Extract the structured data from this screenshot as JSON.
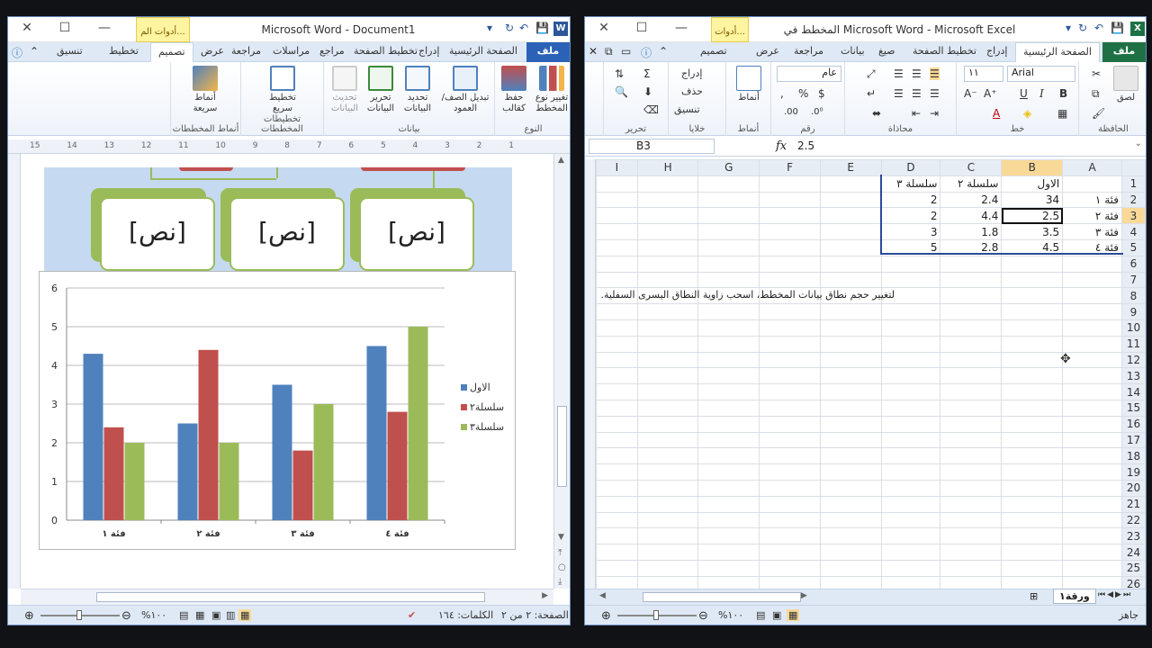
{
  "word": {
    "title": "Microsoft Word  -  Document1",
    "context_tab": "أدوات الم...",
    "tabs": [
      "ملف",
      "الصفحة الرئيسية",
      "إدراج",
      "تخطيط الصفحة",
      "مراجع",
      "مراسلات",
      "مراجعة",
      "عرض",
      "تصميم",
      "تخطيط",
      "تنسيق"
    ],
    "ribbon": {
      "groups": [
        {
          "label": "النوع",
          "buttons": [
            "تغيير نوع المخطط",
            "حفظ كقالب"
          ]
        },
        {
          "label": "بيانات",
          "buttons": [
            "تبديل الصف/العمود",
            "تحديد البيانات",
            "تحرير البيانات",
            "تحديث البيانات"
          ]
        },
        {
          "label": "تخطيطات المخططات",
          "buttons": [
            "تخطيط سريع"
          ]
        },
        {
          "label": "أنماط المخططات",
          "buttons": [
            "أنماط سريعة"
          ]
        }
      ]
    },
    "ruler_ticks": [
      "15",
      "14",
      "13",
      "12",
      "11",
      "10",
      "9",
      "8",
      "7",
      "6",
      "5",
      "4",
      "3",
      "2",
      "1"
    ],
    "smartart_text": "[نص]",
    "status": {
      "page": "الصفحة: ٢ من ٢",
      "words": "الكلمات: ١٦٤",
      "zoom": "%١٠٠"
    }
  },
  "excel": {
    "title": "المخطط في Microsoft Word  -  Microsoft Excel",
    "context_tab": "أدوات...",
    "tabs": [
      "ملف",
      "الصفحة الرئيسية",
      "إدراج",
      "تخطيط الصفحة",
      "صيغ",
      "بيانات",
      "مراجعة",
      "عرض",
      "تصميم"
    ],
    "ribbon": {
      "groups": [
        "الحافظة",
        "خط",
        "محاذاة",
        "رقم",
        "أنماط",
        "خلايا",
        "تحرير"
      ],
      "font_name": "Arial",
      "font_size": "١١",
      "number_format": "عام",
      "paste_label": "لصق",
      "styles_label": "أنماط",
      "cells_buttons": [
        "إدراج",
        "حذف",
        "تنسيق"
      ]
    },
    "name_box": "B3",
    "formula": "2.5",
    "columns": [
      "I",
      "H",
      "G",
      "F",
      "E",
      "D",
      "C",
      "B",
      "A"
    ],
    "rows": [
      [
        "",
        "",
        "",
        "",
        "",
        "سلسلة ٣",
        "سلسلة ٢",
        "الاول",
        ""
      ],
      [
        "",
        "",
        "",
        "",
        "",
        "2",
        "2.4",
        "34",
        "فئة ١"
      ],
      [
        "",
        "",
        "",
        "",
        "",
        "2",
        "4.4",
        "2.5",
        "فئة ٢"
      ],
      [
        "",
        "",
        "",
        "",
        "",
        "3",
        "1.8",
        "3.5",
        "فئة ٣"
      ],
      [
        "",
        "",
        "",
        "",
        "",
        "5",
        "2.8",
        "4.5",
        "فئة ٤"
      ]
    ],
    "total_rows": 26,
    "note": "لتغيير حجم نطاق بيانات المخطط، اسحب زاوية النطاق اليسرى السفلية.",
    "sheet_tab": "ورقة١",
    "status": "جاهز",
    "zoom": "%١٠٠"
  },
  "chart_data": {
    "type": "bar",
    "categories": [
      "فئة ١",
      "فئة ٢",
      "فئة ٣",
      "فئة ٤"
    ],
    "series": [
      {
        "name": "الاول",
        "color": "#4f81bd",
        "values": [
          4.3,
          2.5,
          3.5,
          4.5
        ]
      },
      {
        "name": "سلسلة٢",
        "color": "#c0504d",
        "values": [
          2.4,
          4.4,
          1.8,
          2.8
        ]
      },
      {
        "name": "سلسلة٣",
        "color": "#9bbb59",
        "values": [
          2,
          2,
          3,
          5
        ]
      }
    ],
    "ylim": [
      0,
      6
    ],
    "yticks": [
      0,
      1,
      2,
      3,
      4,
      5,
      6
    ],
    "grid": true,
    "legend": "right"
  }
}
